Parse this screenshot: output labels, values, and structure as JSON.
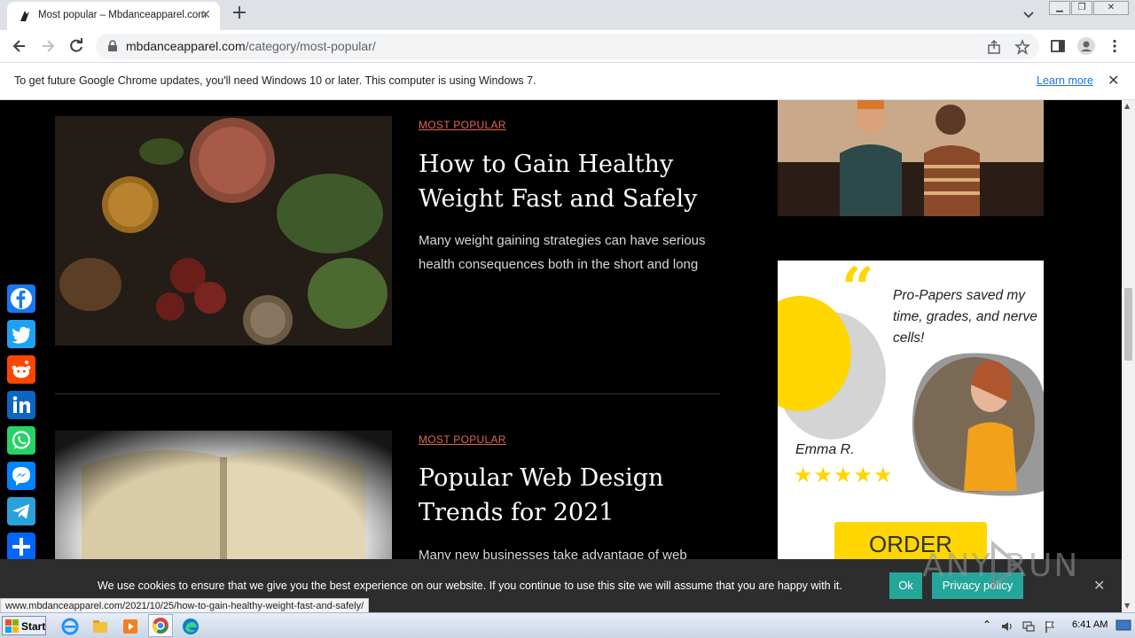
{
  "browser": {
    "tab_title": "Most popular – Mbdanceapparel.com",
    "tab_close": "✕",
    "new_tab": "+",
    "url_domain": "mbdanceapparel.com",
    "url_path": "/category/most-popular/"
  },
  "infobar": {
    "message": "To get future Google Chrome updates, you'll need Windows 10 or later. This computer is using Windows 7.",
    "learn_more": "Learn more",
    "close": "✕"
  },
  "posts": [
    {
      "category": "MOST POPULAR",
      "title": "How to Gain Healthy Weight Fast and Safely",
      "excerpt": "Many weight gaining strategies can have serious health consequences both in the short and long"
    },
    {
      "category": "MOST POPULAR",
      "title": "Popular Web Design Trends for 2021",
      "excerpt": "Many new businesses take advantage of web"
    }
  ],
  "share_buttons": [
    {
      "name": "facebook",
      "color": "#1877f2"
    },
    {
      "name": "twitter",
      "color": "#1da1f2"
    },
    {
      "name": "reddit",
      "color": "#ff4500"
    },
    {
      "name": "linkedin",
      "color": "#0a66c2"
    },
    {
      "name": "whatsapp",
      "color": "#25d366"
    },
    {
      "name": "messenger",
      "color": "#0084ff"
    },
    {
      "name": "telegram",
      "color": "#2aa1da"
    },
    {
      "name": "share",
      "color": "#0166ff"
    }
  ],
  "ad": {
    "quote": "Pro-Papers saved my time, grades, and nerve cells!",
    "reviewer": "Emma R.",
    "stars": "★★★★★",
    "rating": 5,
    "cta": "ORDER"
  },
  "cookie": {
    "message": "We use cookies to ensure that we give you the best experience on our website. If you continue to use this site we will assume that you are happy with it.",
    "ok": "Ok",
    "privacy": "Privacy policy",
    "close": "✕"
  },
  "status_url": "www.mbdanceapparel.com/2021/10/25/how-to-gain-healthy-weight-fast-and-safely/",
  "watermark": "ANY RUN",
  "taskbar": {
    "start": "Start",
    "clock": "6:41 AM"
  }
}
